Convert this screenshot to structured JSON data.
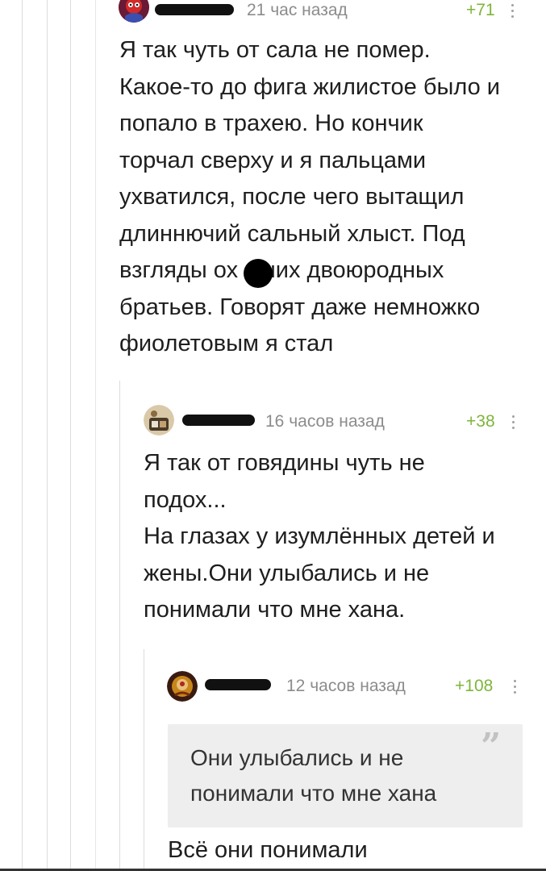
{
  "comments": [
    {
      "time": "21 час назад",
      "rating": "+71",
      "text": "Я так чуть от сала не помер.\nКакое-то до фига жилистое было и\nпопало в трахею. Но кончик\nторчал сверху и я пальцами\nухватился, после чего вытащил\nдлиннючий сальный хлыст. Под\nвзгляды ох   вших двоюродных\nбратьев. Говорят даже немножко\nфиолетовым я стал"
    },
    {
      "time": "16 часов назад",
      "rating": "+38",
      "text": "Я так от говядины чуть не\nподох...\nНа глазах у изумлённых детей и\nжены.Они улыбались и не\nпонимали что мне хана."
    },
    {
      "time": "12 часов назад",
      "rating": "+108",
      "quote": "Они улыбались и не\nпонимали что мне хана",
      "text": "Всё они понимали"
    }
  ],
  "icons": {
    "quote_mark": "”",
    "more": "vertical-ellipsis-icon"
  },
  "colors": {
    "rating": "#7eb53a",
    "time": "#8c8c8c",
    "quote_bg": "#eeeeee"
  }
}
